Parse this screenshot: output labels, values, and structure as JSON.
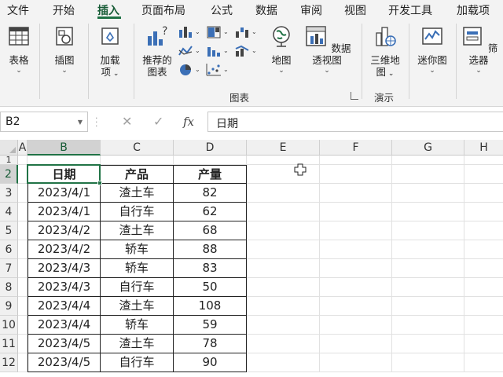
{
  "menu": {
    "tabs": [
      "文件",
      "开始",
      "插入",
      "页面布局",
      "公式",
      "数据",
      "审阅",
      "视图",
      "开发工具",
      "加载项"
    ],
    "active": "插入"
  },
  "ribbon": {
    "table_btn": "表格",
    "illustrations_btn": "插图",
    "addins_btn_line1": "加载",
    "addins_btn_line2": "项",
    "recommended_line1": "推荐的",
    "recommended_line2": "图表",
    "map_btn": "地图",
    "pivotchart_btn": "数据透视图",
    "map3d_line1": "三维地",
    "map3d_line2": "图",
    "sparkline_btn": "迷你图",
    "slicer_btn": "筛选器",
    "group_charts": "图表",
    "group_tours": "演示",
    "colors": {
      "accent_green": "#217346",
      "chart_blue": "#3b6fb6"
    },
    "icons": [
      "table-icon",
      "illustrations-icon",
      "addins-icon",
      "recommended-charts-icon",
      "bar-chart-icon",
      "line-chart-icon",
      "pie-chart-icon",
      "map-icon",
      "pivot-chart-icon",
      "3d-map-icon",
      "sparkline-icon",
      "slicer-icon"
    ]
  },
  "formula_bar": {
    "name_box": "B2",
    "formula": "日期",
    "cancel_glyph": "✕",
    "enter_glyph": "✓",
    "fx_label": "fx"
  },
  "sheet": {
    "columns": [
      "A",
      "B",
      "C",
      "D",
      "E",
      "F",
      "G",
      "H"
    ],
    "rows": [
      "1",
      "2",
      "3",
      "4",
      "5",
      "6",
      "7",
      "8",
      "9",
      "10",
      "11",
      "12"
    ],
    "selected_cell": "B2",
    "table_header": [
      "日期",
      "产品",
      "产量"
    ],
    "table_rows": [
      [
        "2023/4/1",
        "渣土车",
        "82"
      ],
      [
        "2023/4/1",
        "自行车",
        "62"
      ],
      [
        "2023/4/2",
        "渣土车",
        "68"
      ],
      [
        "2023/4/2",
        "轿车",
        "88"
      ],
      [
        "2023/4/3",
        "轿车",
        "83"
      ],
      [
        "2023/4/3",
        "自行车",
        "50"
      ],
      [
        "2023/4/4",
        "渣土车",
        "108"
      ],
      [
        "2023/4/4",
        "轿车",
        "59"
      ],
      [
        "2023/4/5",
        "渣土车",
        "78"
      ],
      [
        "2023/4/5",
        "自行车",
        "90"
      ]
    ]
  }
}
